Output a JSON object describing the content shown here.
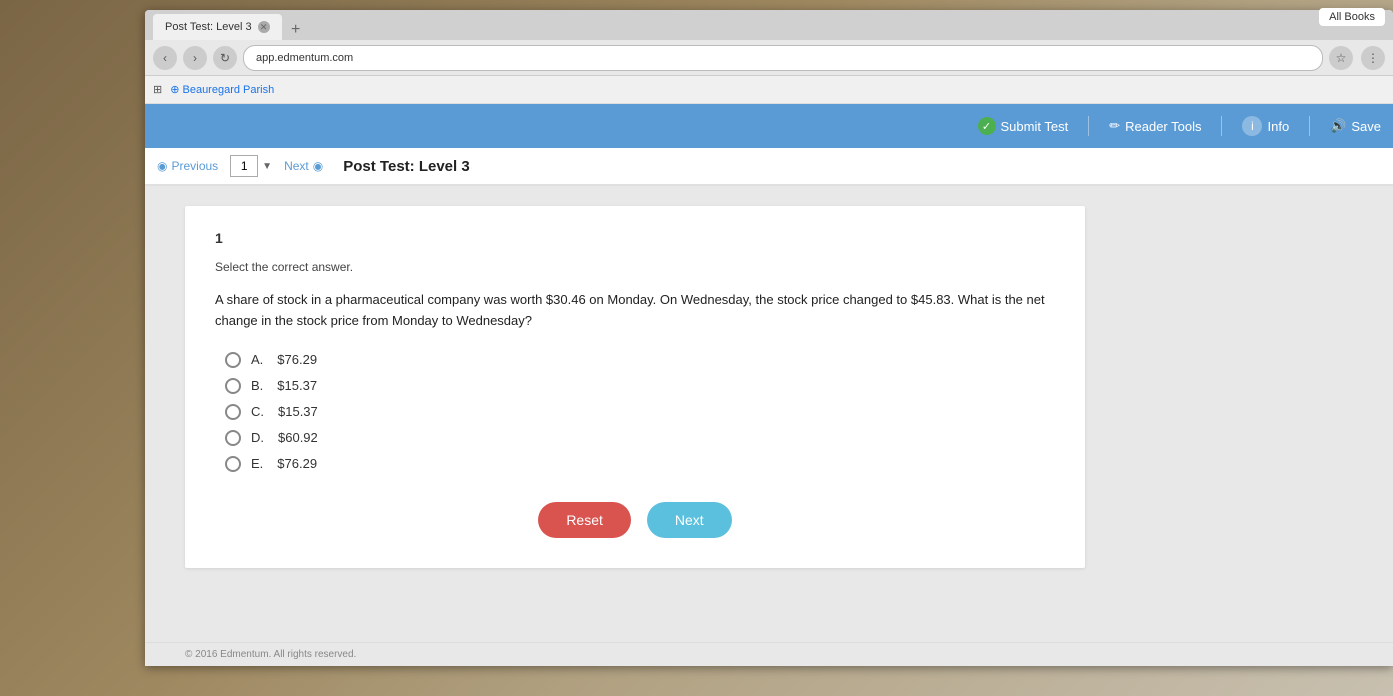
{
  "browser": {
    "tab_label": "Post Test: Level 3",
    "address_url": "app.edmentum.com",
    "all_books_label": "All Books"
  },
  "toolbar": {
    "submit_test_label": "Submit Test",
    "reader_tools_label": "Reader Tools",
    "info_label": "Info",
    "save_label": "Save"
  },
  "test_nav": {
    "previous_label": "Previous",
    "next_label": "Next",
    "question_number": "1",
    "title": "Post Test: Level 3"
  },
  "question": {
    "number": "1",
    "instruction": "Select the correct answer.",
    "text": "A share of stock in a pharmaceutical company was worth $30.46 on Monday. On Wednesday, the stock price changed to $45.83. What is the net change in the stock price from Monday to Wednesday?",
    "options": [
      {
        "letter": "A.",
        "value": "$76.29"
      },
      {
        "letter": "B.",
        "value": "$15.37"
      },
      {
        "letter": "C.",
        "value": "$15.37"
      },
      {
        "letter": "D.",
        "value": "$60.92"
      },
      {
        "letter": "E.",
        "value": "$76.29"
      }
    ]
  },
  "buttons": {
    "reset_label": "Reset",
    "next_label": "Next"
  },
  "footer": {
    "copyright": "© 2016 Edmentum. All rights reserved."
  }
}
